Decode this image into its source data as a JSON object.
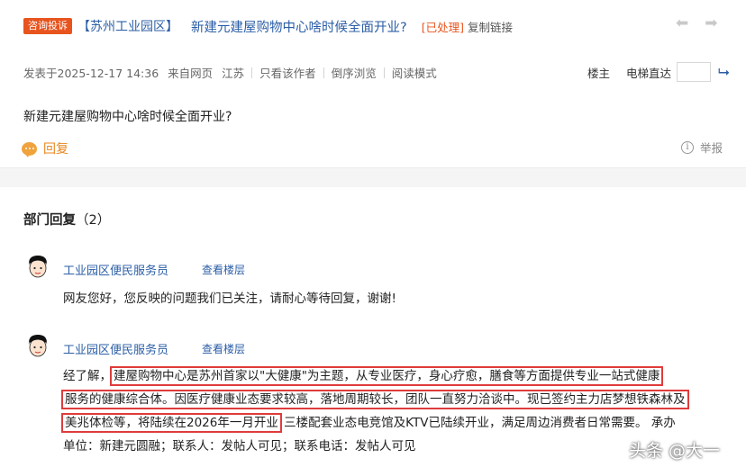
{
  "header": {
    "tag": "咨询投诉",
    "region": "【苏州工业园区】",
    "title": "新建元建屋购物中心啥时候全面开业?",
    "status": "[已处理]",
    "copy_link": "复制链接",
    "prev_icon": "arrow-left-icon",
    "next_icon": "arrow-right-icon"
  },
  "meta": {
    "posted": "发表于2025-12-17 14:36",
    "source": "来自网页",
    "location": "江苏",
    "author_only": "只看该作者",
    "reverse": "倒序浏览",
    "read_mode": "阅读模式",
    "floor_owner": "楼主",
    "elevator": "电梯直达"
  },
  "post": {
    "body": "新建元建屋购物中心啥时候全面开业?",
    "reply": "回复",
    "report": "举报"
  },
  "replies_section": {
    "title": "部门回复",
    "count": "（2）"
  },
  "replies": [
    {
      "name": "工业园区便民服务员",
      "view_floor": "查看楼层",
      "text": "网友您好，您反映的问题我们已关注，请耐心等待回复，谢谢!"
    },
    {
      "name": "工业园区便民服务员",
      "view_floor": "查看楼层",
      "intro": "经了解，",
      "hl1": "建屋购物中心是苏州首家以\"大健康\"为主题，从专业医疗，身心疗愈，膳食等方面提供专业一站式健康",
      "hl2": "服务的健康综合体。因医疗健康业态要求较高，落地周期较长，团队一直努力洽谈中。现已签约主力店梦想铁森林及",
      "hl3": "美兆体检等，将陆续在2026年一月开业",
      "tail3": "三楼配套业态电竞馆及KTV已陆续开业，满足周边消费者日常需要。 承办",
      "line4": "单位：新建元圆融；联系人：发帖人可见；联系电话：发帖人可见"
    }
  ],
  "watermark": "头条 @大一",
  "colors": {
    "accent_orange": "#e8541e",
    "link_blue": "#2b5ea6",
    "highlight_red": "#e03b3b"
  }
}
